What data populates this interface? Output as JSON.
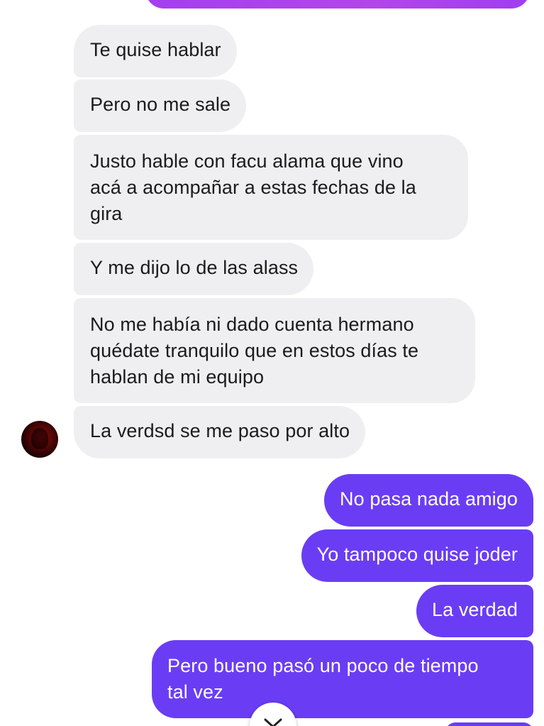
{
  "conversation": {
    "incoming": [
      {
        "text": "Te quise hablar"
      },
      {
        "text": "Pero no me sale"
      },
      {
        "lines": [
          "Justo hable con facu alama que vino",
          "acá a acompañar a estas fechas de la",
          "gira"
        ]
      },
      {
        "text": "Y me dijo lo de las alass"
      },
      {
        "lines": [
          "No me había ni dado cuenta hermano",
          "quédate tranquilo que en estos días te",
          "hablan de mi equipo"
        ]
      },
      {
        "text": "La verdsd se me paso por alto"
      }
    ],
    "outgoing": [
      {
        "text": "No pasa nada amigo"
      },
      {
        "text": "Yo tampoco quise joder"
      },
      {
        "text": "La verdad"
      },
      {
        "lines": [
          "Pero bueno pasó un poco de tiempo",
          "tal vez"
        ]
      }
    ]
  },
  "icons": {
    "avatar": "contact-avatar",
    "scroll": "chevron-down-icon"
  },
  "colors": {
    "incoming_bubble": "#efeff1",
    "outgoing_bubble": "#6a3df4",
    "top_bubble": "#a43ff0",
    "incoming_text": "#1b1b1b",
    "outgoing_text": "#ffffff"
  }
}
